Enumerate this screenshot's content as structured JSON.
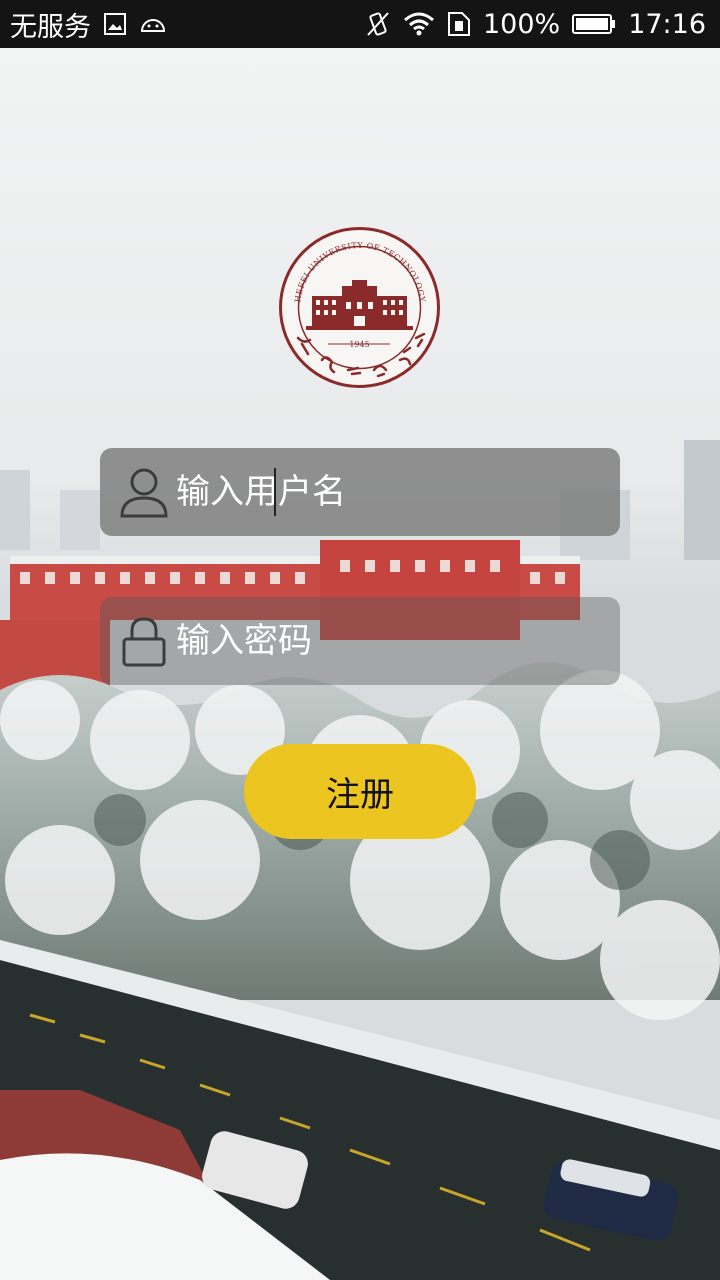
{
  "status_bar": {
    "carrier": "无服务",
    "battery": "100%",
    "time": "17:16",
    "icons": [
      "image-icon",
      "android-icon",
      "vibrate-icon",
      "wifi-icon",
      "sim-icon",
      "battery-icon"
    ]
  },
  "logo": {
    "name": "hfut-seal-logo",
    "arc_text": "HEFEI UNIVERSITY OF TECHNOLOGY",
    "year": "1945"
  },
  "login": {
    "username_placeholder": "输入用户名",
    "password_placeholder": "输入密码",
    "register_label": "注册"
  },
  "colors": {
    "status_bar": "#141414",
    "button": "#ecc520",
    "seal": "#8b2a2a"
  }
}
